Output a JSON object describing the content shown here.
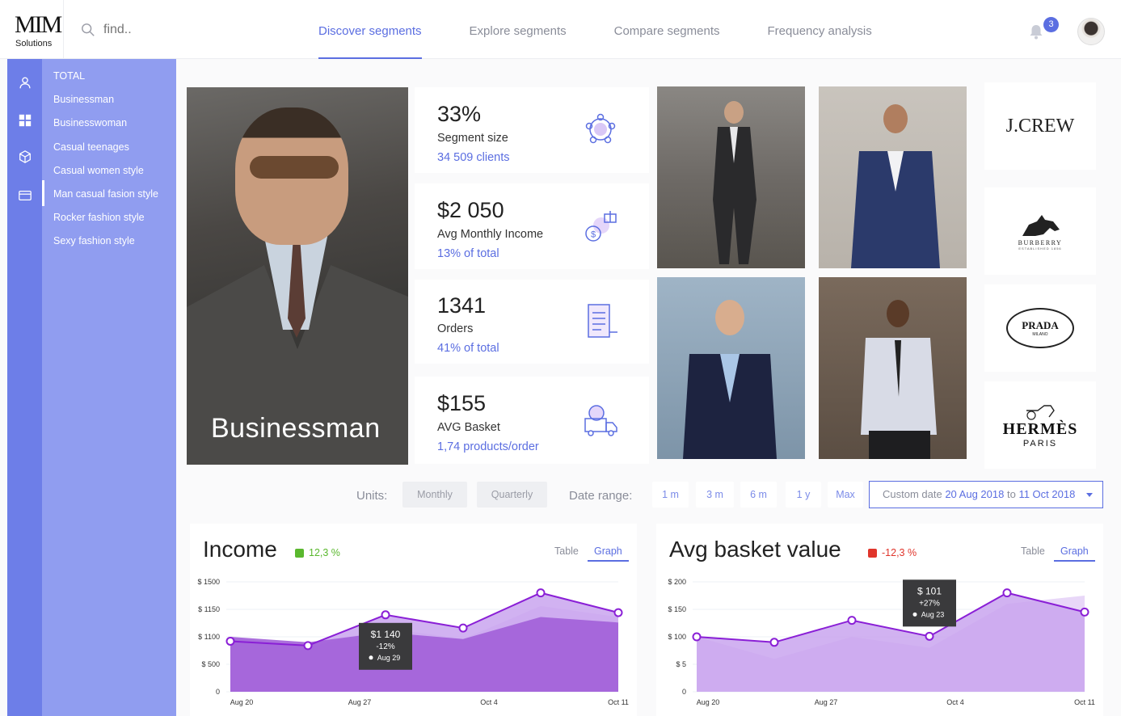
{
  "brand": {
    "mark": "MIM",
    "sub": "Solutions"
  },
  "search": {
    "placeholder": "find.."
  },
  "nav": {
    "tabs": [
      {
        "label": "Discover segments"
      },
      {
        "label": "Explore segments"
      },
      {
        "label": "Compare segments"
      },
      {
        "label": "Frequency analysis"
      }
    ]
  },
  "notifications": {
    "count": "3"
  },
  "sidebar": {
    "items": [
      {
        "label": "TOTAL"
      },
      {
        "label": "Businessman"
      },
      {
        "label": "Businesswoman"
      },
      {
        "label": "Casual teenages"
      },
      {
        "label": "Casual women style"
      },
      {
        "label": "Man casual fasion style"
      },
      {
        "label": "Rocker fashion style"
      },
      {
        "label": "Sexy fashion style"
      }
    ]
  },
  "hero": {
    "title": "Businessman"
  },
  "kpis": [
    {
      "value": "33%",
      "label": "Segment size",
      "sub": "34 509 clients",
      "icon": "people-network-icon"
    },
    {
      "value": "$2 050",
      "label": "Avg Monthly Income",
      "sub": "13%  of total",
      "icon": "money-gift-icon"
    },
    {
      "value": "1341",
      "label": "Orders",
      "sub": "41%  of total",
      "icon": "order-list-icon"
    },
    {
      "value": "$155",
      "label": "AVG Basket",
      "sub": "1,74  products/order",
      "icon": "delivery-truck-icon"
    }
  ],
  "brands": [
    {
      "name": "J.CREW"
    },
    {
      "name": "BURBERRY",
      "sub": "ESTABLISHED 1856"
    },
    {
      "name": "PRADA",
      "sub": "MILANO"
    },
    {
      "name": "HERMÈS",
      "sub": "PARIS"
    }
  ],
  "filters": {
    "units_label": "Units:",
    "units": [
      "Monthly",
      "Quarterly"
    ],
    "range_label": "Date range:",
    "ranges": [
      "1 m",
      "3 m",
      "6 m",
      "1 y",
      "Max"
    ],
    "custom_prefix": "Custom date",
    "custom_from": "20 Aug 2018",
    "custom_to_word": "to",
    "custom_to": "11 Oct 2018"
  },
  "income": {
    "title": "Income",
    "delta": "12,3 %",
    "delta_color": "#5ab82e",
    "toggle_table": "Table",
    "toggle_graph": "Graph",
    "tooltip": {
      "value": "$1 140",
      "change": "-12%",
      "date": "Aug 29"
    }
  },
  "basket": {
    "title": "Avg basket value",
    "delta": "-12,3 %",
    "delta_color": "#e0352b",
    "toggle_table": "Table",
    "toggle_graph": "Graph",
    "tooltip": {
      "value": "$ 101",
      "change": "+27%",
      "date": "Aug 23"
    }
  },
  "chart_data": [
    {
      "type": "area",
      "title": "Income",
      "yticks": [
        "$ 1500",
        "$ 1150",
        "$ 1100",
        "$ 500",
        "0"
      ],
      "xticks": [
        "Aug 20",
        "Aug 27",
        "Oct 4",
        "Oct 11"
      ],
      "series": [
        {
          "values": [
            1100,
            1000,
            1180,
            1080,
            1380,
            1280
          ]
        },
        {
          "values": [
            1060,
            1020,
            1300,
            1180,
            1500,
            1320
          ]
        },
        {
          "values": [
            1100,
            1050,
            1140,
            1080,
            1280,
            1230
          ]
        }
      ],
      "accent": "#8a1fd6"
    },
    {
      "type": "area",
      "title": "Avg basket value",
      "yticks": [
        "$ 200",
        "$ 150",
        "$ 100",
        "$ 5",
        "0"
      ],
      "xticks": [
        "Aug 20",
        "Aug 27",
        "Oct 4",
        "Oct 11"
      ],
      "series": [
        {
          "values": [
            100,
            60,
            100,
            80,
            160,
            175
          ]
        },
        {
          "values": [
            100,
            90,
            130,
            101,
            180,
            145
          ]
        }
      ],
      "accent": "#8a1fd6"
    }
  ]
}
